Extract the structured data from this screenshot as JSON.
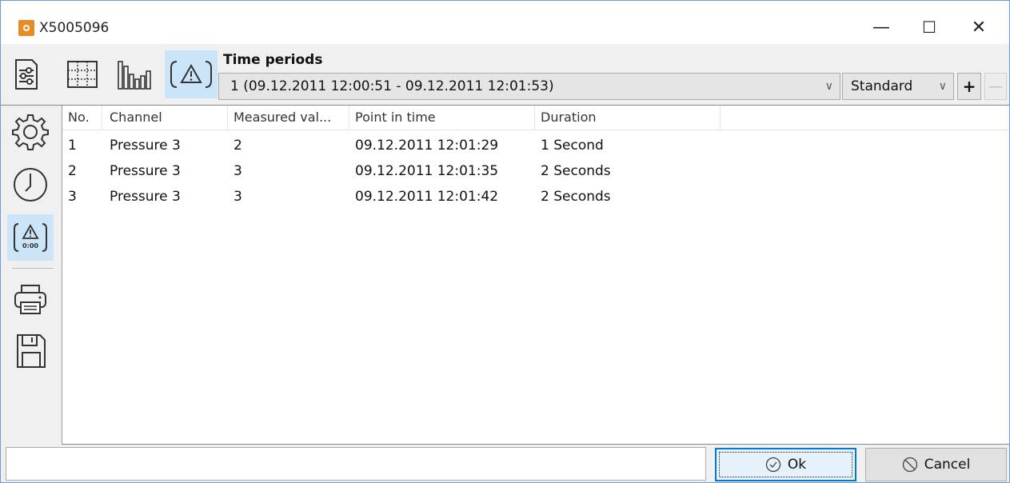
{
  "window": {
    "title": "X5005096",
    "minimize_glyph": "—",
    "maximize_glyph": "☐",
    "close_glyph": "✕"
  },
  "toolbar": {
    "buttons": [
      {
        "icon": "settings-sliders-icon",
        "active": false
      },
      {
        "icon": "table-grid-icon",
        "active": false
      },
      {
        "icon": "bar-chart-icon",
        "active": false
      },
      {
        "icon": "alarm-warning-icon",
        "active": true
      }
    ],
    "time_periods_label": "Time periods",
    "time_period_value": "1 (09.12.2011 12:00:51 - 09.12.2011 12:01:53)",
    "standard_value": "Standard",
    "chevron_glyph": "∨",
    "plus_glyph": "+",
    "minus_glyph": "—"
  },
  "sidebar": {
    "items": [
      {
        "icon": "gear-icon",
        "active": false
      },
      {
        "icon": "clock-icon",
        "active": false
      },
      {
        "icon": "alarm-counter-icon",
        "active": true,
        "badge": "0:00"
      },
      {
        "icon": "printer-icon",
        "active": false
      },
      {
        "icon": "save-icon",
        "active": false
      }
    ]
  },
  "table": {
    "columns": [
      "No.",
      "Channel",
      "Measured val...",
      "Point in time",
      "Duration"
    ],
    "rows": [
      [
        "1",
        "Pressure 3",
        "2",
        "09.12.2011 12:01:29",
        "1 Second"
      ],
      [
        "2",
        "Pressure 3",
        "3",
        "09.12.2011 12:01:35",
        "2 Seconds"
      ],
      [
        "3",
        "Pressure 3",
        "3",
        "09.12.2011 12:01:42",
        "2 Seconds"
      ]
    ]
  },
  "footer": {
    "ok_label": "Ok",
    "cancel_label": "Cancel"
  },
  "colors": {
    "active_bg": "#cce4f7",
    "accent": "#0078d7",
    "app_icon": "#e98a24"
  }
}
